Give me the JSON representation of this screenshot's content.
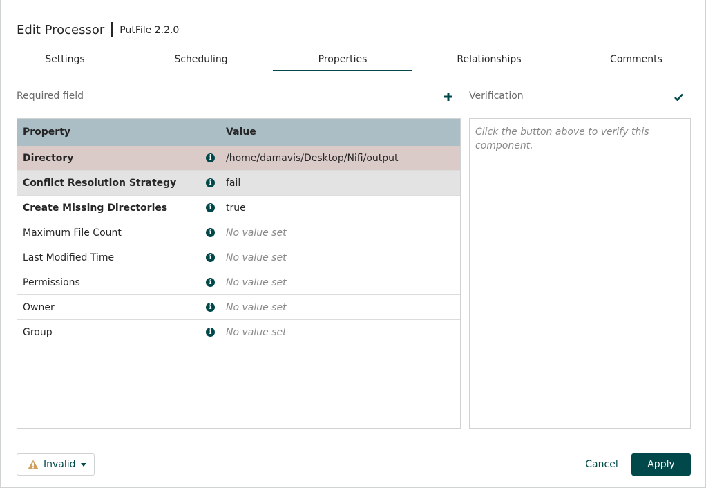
{
  "dialog": {
    "title": "Edit Processor",
    "subtitle": "PutFile 2.2.0"
  },
  "tabs": [
    {
      "label": "Settings"
    },
    {
      "label": "Scheduling"
    },
    {
      "label": "Properties",
      "active": true
    },
    {
      "label": "Relationships"
    },
    {
      "label": "Comments"
    }
  ],
  "properties": {
    "required_label": "Required field",
    "add_icon": "plus-icon",
    "columns": {
      "property": "Property",
      "value": "Value"
    },
    "rows": [
      {
        "name": "Directory",
        "value": "/home/damavis/Desktop/Nifi/output"
      },
      {
        "name": "Conflict Resolution Strategy",
        "value": "fail"
      },
      {
        "name": "Create Missing Directories",
        "value": "true"
      },
      {
        "name": "Maximum File Count",
        "value": "No value set"
      },
      {
        "name": "Last Modified Time",
        "value": "No value set"
      },
      {
        "name": "Permissions",
        "value": "No value set"
      },
      {
        "name": "Owner",
        "value": "No value set"
      },
      {
        "name": "Group",
        "value": "No value set"
      }
    ],
    "info_icon": "info-icon"
  },
  "verification": {
    "label": "Verification",
    "icon": "checkmark-icon",
    "placeholder": "Click the button above to verify this component."
  },
  "footer": {
    "status_label": "Invalid",
    "status_icon": "warning-icon",
    "cancel_label": "Cancel",
    "apply_label": "Apply"
  },
  "colors": {
    "accent": "#004849",
    "header_bg": "#abbdc5",
    "selected_row": "#dbcbc8",
    "warning": "#cf9f5d"
  }
}
